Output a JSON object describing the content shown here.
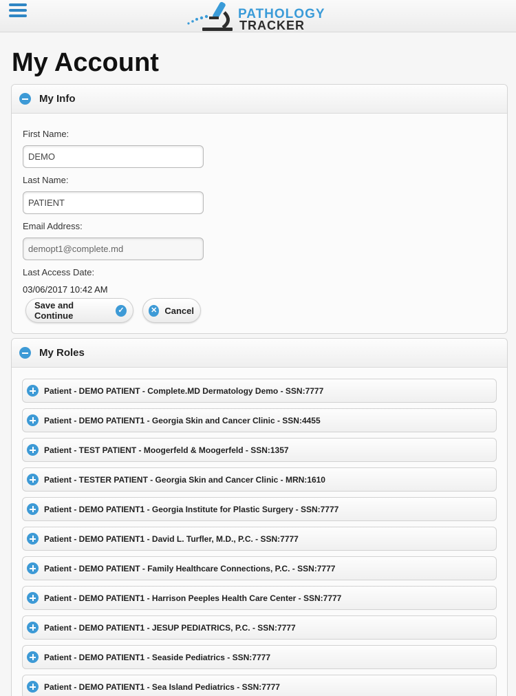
{
  "header": {
    "logo_line1": "PATHOLOGY",
    "logo_line2": "TRACKER",
    "accent_color": "#3a9bd8"
  },
  "page": {
    "title": "My Account"
  },
  "my_info": {
    "heading": "My Info",
    "first_name_label": "First Name:",
    "first_name_value": "DEMO",
    "last_name_label": "Last Name:",
    "last_name_value": "PATIENT",
    "email_label": "Email Address:",
    "email_value": "demopt1@complete.md",
    "last_access_label": "Last Access Date:",
    "last_access_value": "03/06/2017 10:42 AM",
    "save_button": "Save and Continue",
    "cancel_button": "Cancel"
  },
  "my_roles": {
    "heading": "My Roles",
    "items": [
      "Patient - DEMO PATIENT - Complete.MD Dermatology Demo - SSN:7777",
      "Patient - DEMO PATIENT1 - Georgia Skin and Cancer Clinic - SSN:4455",
      "Patient - TEST PATIENT - Moogerfeld & Moogerfeld - SSN:1357",
      "Patient - TESTER PATIENT - Georgia Skin and Cancer Clinic - MRN:1610",
      "Patient - DEMO PATIENT1 - Georgia Institute for Plastic Surgery - SSN:7777",
      "Patient - DEMO PATIENT1 - David L. Turfler, M.D., P.C. - SSN:7777",
      "Patient - DEMO PATIENT - Family Healthcare Connections, P.C. - SSN:7777",
      "Patient - DEMO PATIENT1 - Harrison Peeples Health Care Center - SSN:7777",
      "Patient - DEMO PATIENT1 - JESUP PEDIATRICS, P.C. - SSN:7777",
      "Patient - DEMO PATIENT1 - Seaside Pediatrics - SSN:7777",
      "Patient - DEMO PATIENT1 - Sea Island Pediatrics - SSN:7777"
    ]
  }
}
